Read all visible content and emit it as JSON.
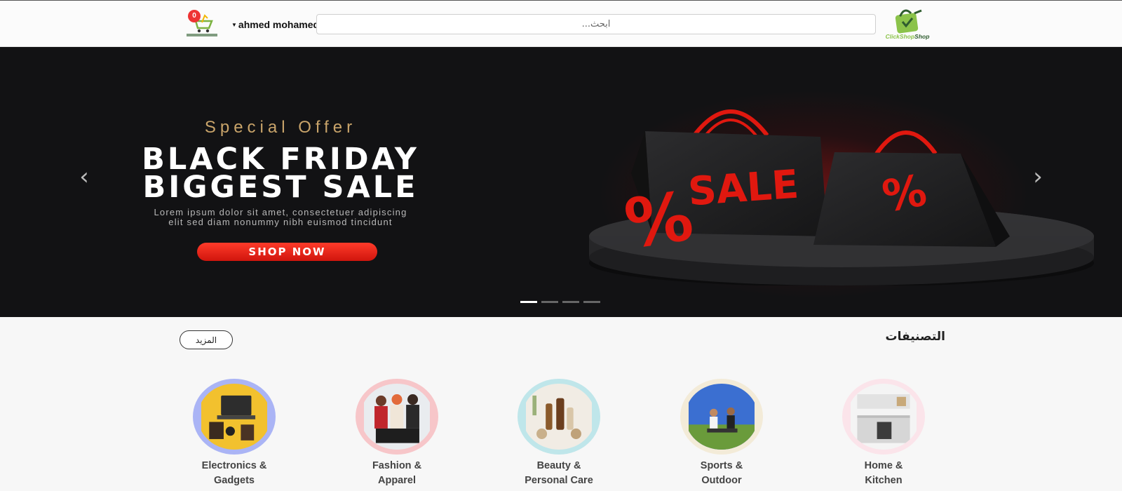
{
  "header": {
    "cart_count": "0",
    "user_name": "ahmed mohamed",
    "search_placeholder": "ابحث...",
    "brand_name_part1": "ClickShop",
    "brand_name_part2": "Shop",
    "icons": [
      "cart-logo-icon",
      "caret-down-icon",
      "brand-bag-icon"
    ]
  },
  "hero": {
    "offer_text": "Special Offer",
    "headline_line1": "BLACK FRIDAY",
    "headline_line2": "BIGGEST SALE",
    "body_line1": "Lorem ipsum dolor sit amet, consectetuer adipiscing",
    "body_line2": "elit sed diam nonummy nibh euismod tincidunt",
    "cta_label": "SHOP NOW",
    "art_sale_text": "SALE",
    "art_percent_text": "%",
    "prev_arrow": "‹",
    "next_arrow": "›",
    "slide_count": 4,
    "active_slide": 1,
    "colors": {
      "background": "#121214",
      "accent": "#e0180f",
      "gold": "#c9a46a"
    }
  },
  "categories": {
    "title": "التصنيفات",
    "more_label": "المزيد",
    "items": [
      {
        "line1": "Electronics &",
        "line2": "Gadgets",
        "ring": "#aab4f5",
        "icon": "electronics-image"
      },
      {
        "line1": "Fashion &",
        "line2": "Apparel",
        "ring": "#f7c6c9",
        "icon": "fashion-image"
      },
      {
        "line1": "Beauty &",
        "line2": "Personal Care",
        "ring": "#bfe6ea",
        "icon": "beauty-image"
      },
      {
        "line1": "Sports &",
        "line2": "Outdoor",
        "ring": "#f3ebd8",
        "icon": "sports-image"
      },
      {
        "line1": "Home &",
        "line2": "Kitchen",
        "ring": "#fbe4ea",
        "icon": "kitchen-image"
      }
    ]
  }
}
